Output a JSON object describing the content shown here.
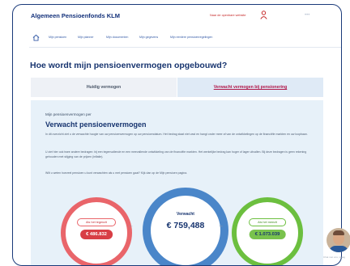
{
  "header": {
    "brand": "Algemeen Pensioenfonds KLM",
    "top_link": "Naar de openbare website"
  },
  "nav": {
    "items": [
      "Mijn pensioen",
      "Mijn planner",
      "Mijn documenten",
      "Mijn gegevens",
      "Mijn eerdere pensioenregelingen"
    ]
  },
  "page": {
    "title": "Hoe wordt mijn pensioenvermogen opgebouwd?"
  },
  "tabs": [
    "Huidig vermogen",
    "Verwacht vermogen bij pensionering"
  ],
  "panel": {
    "eyebrow": "Mijn pensioenvermogen per",
    "title": "Verwacht pensioenvermogen",
    "p1": "In dit overzicht ziet u de verwachte hoogte van uw pensioenvermogen op uw pensioendatum. Het bedrag staat niet vast en hangt onder meer af van de ontwikkelingen op de financiële markten en uw loopbaan.",
    "p2": "U ziet hier ook twee andere bedragen: bij een tegenvallende en een meevallende ontwikkeling van de financiële markten. Het werkelijke bedrag kan hoger of lager uitvallen. Bij deze bedragen is geen rekening gehouden met stijging van de prijzen (inflatie).",
    "p3": "Wilt u weten hoeveel pensioen u kunt verwachten als u met pensioen gaat? Kijk dan op de Mijn pensioen pagina."
  },
  "scenarios": {
    "bad": {
      "label": "Als het tegenzit",
      "value": "€ 486.832"
    },
    "expected": {
      "label": "Verwacht",
      "value": "€ 759,488"
    },
    "good": {
      "label": "Als het meezit",
      "value": "€ 1.073.039"
    }
  },
  "avatar": {
    "caption": "Chat met ons, vraag"
  },
  "colors": {
    "brand": "#12307a",
    "accent": "#b0184a",
    "bad": "#e9656a",
    "expected": "#4a86c9",
    "good": "#6cbf3f"
  }
}
